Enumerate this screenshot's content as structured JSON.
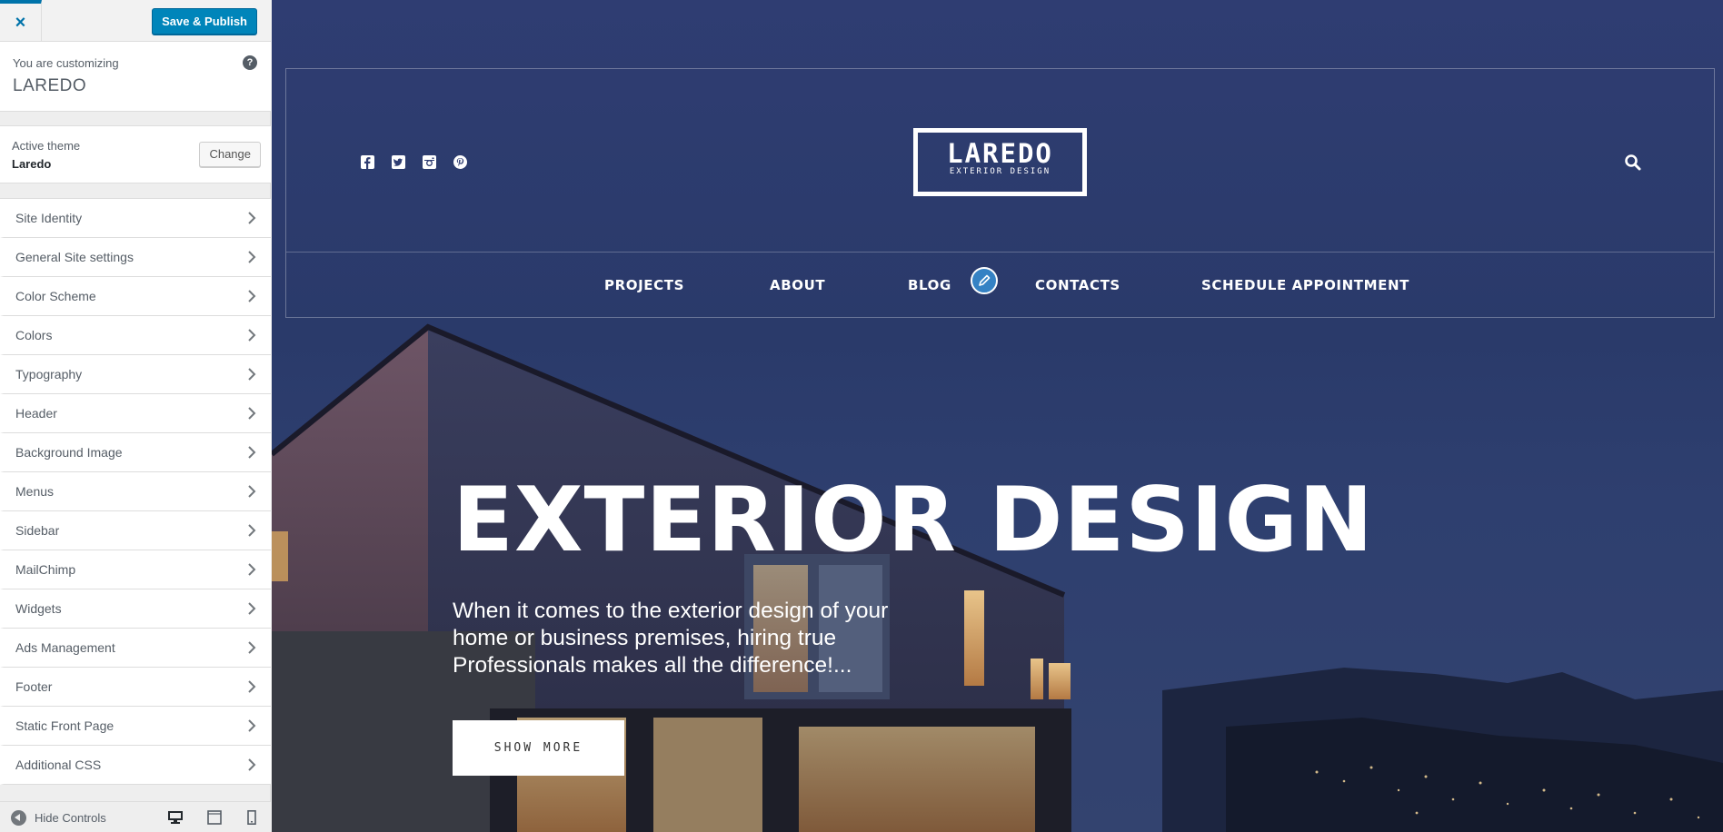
{
  "sidebar": {
    "close_symbol": "×",
    "publish_label": "Save & Publish",
    "customizing_label": "You are customizing",
    "site_name": "LAREDO",
    "help_symbol": "?",
    "active_theme_label": "Active theme",
    "active_theme_name": "Laredo",
    "change_label": "Change",
    "sections": [
      {
        "label": "Site Identity"
      },
      {
        "label": "General Site settings"
      },
      {
        "label": "Color Scheme"
      },
      {
        "label": "Colors"
      },
      {
        "label": "Typography"
      },
      {
        "label": "Header"
      },
      {
        "label": "Background Image"
      },
      {
        "label": "Menus"
      },
      {
        "label": "Sidebar"
      },
      {
        "label": "MailChimp"
      },
      {
        "label": "Widgets"
      },
      {
        "label": "Ads Management"
      },
      {
        "label": "Footer"
      },
      {
        "label": "Static Front Page"
      },
      {
        "label": "Additional CSS"
      }
    ],
    "hide_controls_label": "Hide Controls",
    "device_icons": [
      "desktop-icon",
      "tablet-icon",
      "mobile-icon"
    ]
  },
  "preview": {
    "social_icons": [
      "facebook-icon",
      "twitter-icon",
      "instagram-icon",
      "pinterest-icon"
    ],
    "logo_title": "LAREDO",
    "logo_subtitle": "EXTERIOR DESIGN",
    "nav": [
      {
        "label": "PROJECTS"
      },
      {
        "label": "ABOUT"
      },
      {
        "label": "BLOG"
      },
      {
        "label": "CONTACTS"
      },
      {
        "label": "SCHEDULE APPOINTMENT"
      }
    ],
    "hero_title": "EXTERIOR DESIGN",
    "hero_text": "When it comes to the exterior design of your home or business premises, hiring true Professionals makes all the difference!...",
    "cta_label": "SHOW MORE"
  },
  "colors": {
    "accent": "#0073aa",
    "publish_bg": "#0085ba",
    "edit_shortcut": "#3582c4",
    "night_sky": "#2f3d72"
  }
}
